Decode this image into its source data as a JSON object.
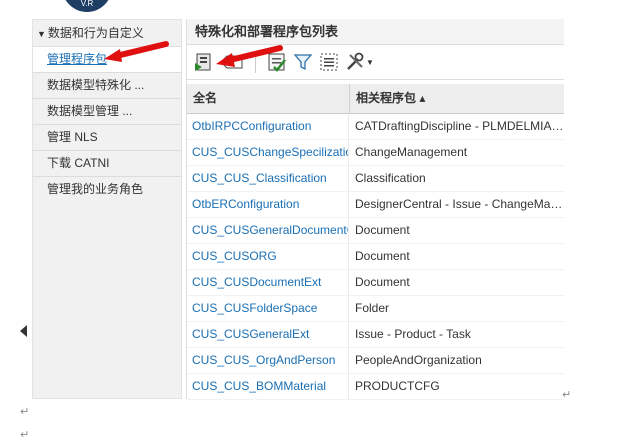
{
  "logo_text": "V.R",
  "sidebar": {
    "header": "数据和行为自定义",
    "items": [
      {
        "label": "管理程序包",
        "active": true
      },
      {
        "label": "数据模型特殊化 ..."
      },
      {
        "label": "数据模型管理 ..."
      },
      {
        "label": "管理 NLS"
      },
      {
        "label": "下载 CATNI"
      },
      {
        "label": "管理我的业务角色"
      }
    ]
  },
  "main": {
    "title": "特殊化和部署程序包列表",
    "columns": [
      "全名",
      "相关程序包 ▴"
    ],
    "rows": [
      {
        "name": "OtbIRPCConfiguration",
        "package": "CATDraftingDiscipline - PLMDELMIASyst..."
      },
      {
        "name": "CUS_CUSChangeSpecilization",
        "package": "ChangeManagement"
      },
      {
        "name": "CUS_CUS_Classification",
        "package": "Classification"
      },
      {
        "name": "OtbERConfiguration",
        "package": "DesignerCentral - Issue - ChangeManag..."
      },
      {
        "name": "CUS_CUSGeneralDocumentC",
        "package": "Document"
      },
      {
        "name": "CUS_CUSORG",
        "package": "Document"
      },
      {
        "name": "CUS_CUSDocumentExt",
        "package": "Document"
      },
      {
        "name": "CUS_CUSFolderSpace",
        "package": "Folder"
      },
      {
        "name": "CUS_CUSGeneralExt",
        "package": "Issue - Product - Task"
      },
      {
        "name": "CUS_CUS_OrgAndPerson",
        "package": "PeopleAndOrganization"
      },
      {
        "name": "CUS_CUS_BOMMaterial",
        "package": "PRODUCTCFG"
      }
    ]
  },
  "icons": [
    "package-import-icon",
    "tag-icon",
    "checklist-icon",
    "filter-icon",
    "select-all-icon",
    "tools-icon",
    "dropdown-arrow-icon",
    "back-arrow-icon"
  ],
  "colors": {
    "link": "#1a6fb4",
    "annotation_arrow": "#e01010",
    "logo": "#1f3e63"
  },
  "return_mark": "↵"
}
